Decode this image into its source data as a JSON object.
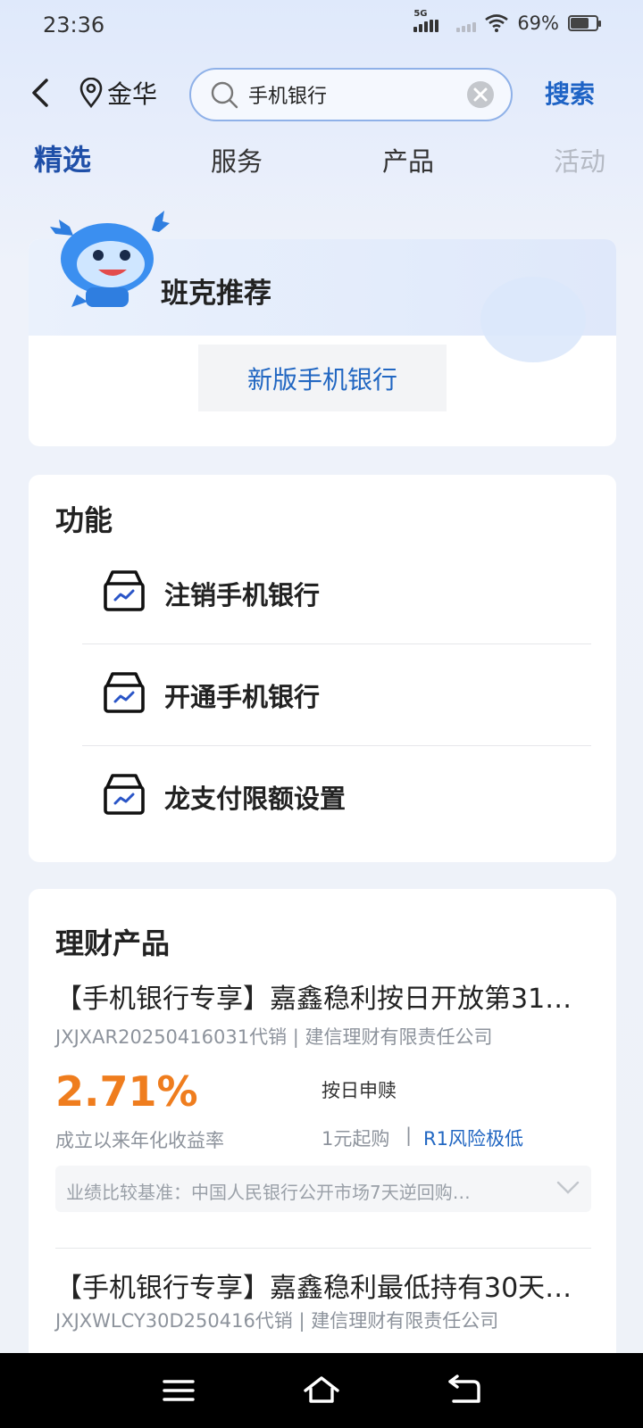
{
  "status": {
    "time": "23:36",
    "network": "5G",
    "battery": "69%",
    "battery_level": 0.69
  },
  "header": {
    "location": "金华",
    "search_value": "手机银行",
    "search_button": "搜索"
  },
  "tabs": [
    {
      "label": "精选",
      "active": true
    },
    {
      "label": "服务"
    },
    {
      "label": "产品"
    },
    {
      "label": "活动"
    }
  ],
  "recommend": {
    "title": "班克推荐",
    "button": "新版手机银行"
  },
  "functions": {
    "title": "功能",
    "items": [
      {
        "label": "注销手机银行",
        "icon": "box-chart-icon"
      },
      {
        "label": "开通手机银行",
        "icon": "box-chart-icon"
      },
      {
        "label": "龙支付限额设置",
        "icon": "box-chart-icon"
      }
    ]
  },
  "products": {
    "title": "理财产品",
    "items": [
      {
        "name": "【手机银行专享】嘉鑫稳利按日开放第31…",
        "sub": "JXJXAR20250416031代销 | 建信理财有限责任公司",
        "rate": "2.71%",
        "rate_label": "成立以来年化收益率",
        "redeem": "按日申赎",
        "min_buy": "1元起购",
        "separator": "|",
        "risk": "R1风险极低",
        "benchmark": "业绩比较基准：中国人民银行公开市场7天逆回购…"
      },
      {
        "name": "【手机银行专享】嘉鑫稳利最低持有30天…",
        "sub": "JXJXWLCY30D250416代销 | 建信理财有限责任公司"
      }
    ]
  },
  "colors": {
    "accent": "#1f4fa8",
    "link": "#2267c2",
    "rate": "#ef7d1e"
  }
}
